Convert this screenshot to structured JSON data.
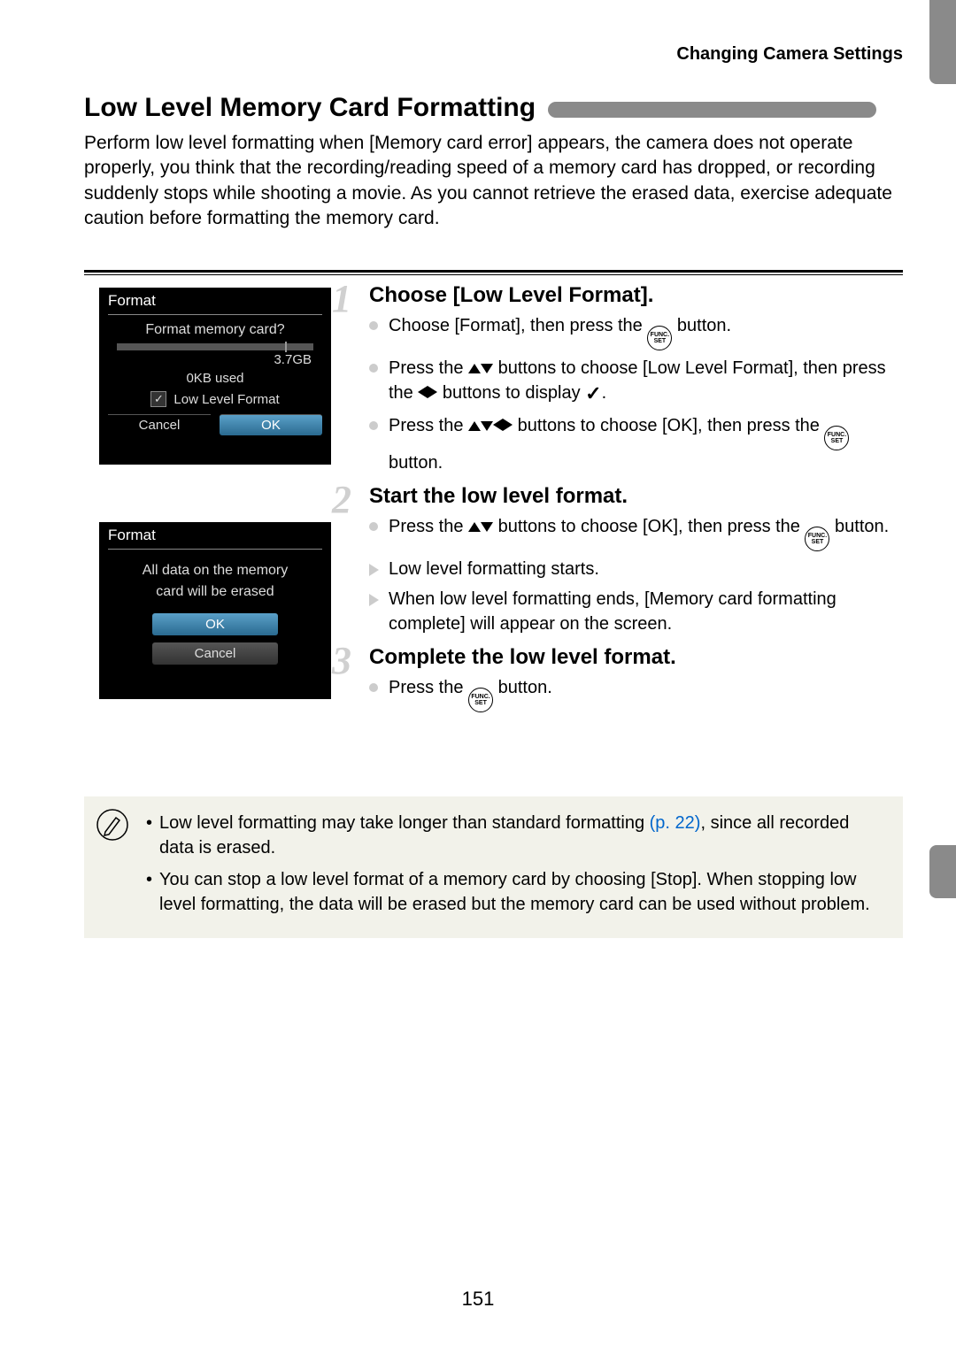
{
  "header": "Changing Camera Settings",
  "section_title": "Low Level Memory Card Formatting",
  "intro": "Perform low level formatting when [Memory card error] appears, the camera does not operate properly, you think that the recording/reading speed of a memory card has dropped, or recording suddenly stops while shooting a movie. As you cannot retrieve the erased data, exercise adequate caution before formatting the memory card.",
  "cam1": {
    "title": "Format",
    "question": "Format memory card?",
    "size": "3.7GB",
    "used": "0KB used",
    "option": "Low Level Format",
    "cancel": "Cancel",
    "ok": "OK"
  },
  "cam2": {
    "title": "Format",
    "msg1": "All data on the memory",
    "msg2": "card will be erased",
    "ok": "OK",
    "cancel": "Cancel"
  },
  "steps": [
    {
      "num": "1",
      "title": "Choose [Low Level Format].",
      "items": [
        {
          "type": "bullet",
          "pre": "Choose [Format], then press the ",
          "icons": [
            "func"
          ],
          "post": " button."
        },
        {
          "type": "bullet",
          "pre": "Press the ",
          "icons": [
            "up",
            "down"
          ],
          "mid": " buttons to choose [Low Level Format], then press the ",
          "icons2": [
            "left",
            "right"
          ],
          "post": " buttons to display ",
          "icons3": [
            "check"
          ],
          "end": "."
        },
        {
          "type": "bullet",
          "pre": "Press the ",
          "icons": [
            "up",
            "down",
            "left",
            "right"
          ],
          "mid": " buttons to choose [OK], then press the ",
          "icons2": [
            "func"
          ],
          "post": " button."
        }
      ]
    },
    {
      "num": "2",
      "title": "Start the low level format.",
      "items": [
        {
          "type": "bullet",
          "pre": "Press the ",
          "icons": [
            "up",
            "down"
          ],
          "mid": " buttons to choose [OK], then press the ",
          "icons2": [
            "func"
          ],
          "post": " button."
        },
        {
          "type": "tri",
          "text": "Low level formatting starts."
        },
        {
          "type": "tri",
          "text": "When low level formatting ends, [Memory card formatting complete] will appear on the screen."
        }
      ]
    },
    {
      "num": "3",
      "title": "Complete the low level format.",
      "items": [
        {
          "type": "bullet",
          "pre": "Press the ",
          "icons": [
            "func"
          ],
          "post": " button."
        }
      ]
    }
  ],
  "notes": [
    {
      "pre": "Low level formatting may take longer than standard formatting ",
      "ref": "(p. 22)",
      "post": ", since all recorded data is erased."
    },
    {
      "text": "You can stop a low level format of a memory card by choosing [Stop]. When stopping low level formatting, the data will be erased but the memory card can be used without problem."
    }
  ],
  "page_number": "151"
}
